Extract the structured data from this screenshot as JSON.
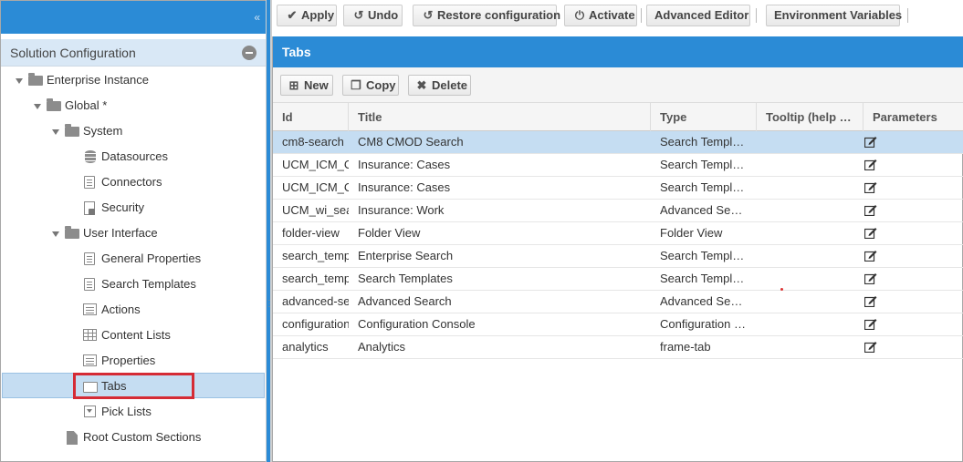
{
  "left": {
    "collapse_glyph": "«",
    "panel_title": "Solution Configuration",
    "tree": [
      {
        "label": "Enterprise Instance",
        "icon": "folder-icon"
      },
      {
        "label": "Global *",
        "icon": "folder-icon"
      },
      {
        "label": "System",
        "icon": "folder-icon"
      },
      {
        "label": "Datasources",
        "icon": "database-icon"
      },
      {
        "label": "Connectors",
        "icon": "document-icon"
      },
      {
        "label": "Security",
        "icon": "lock-document-icon"
      },
      {
        "label": "User Interface",
        "icon": "folder-icon"
      },
      {
        "label": "General Properties",
        "icon": "document-icon"
      },
      {
        "label": "Search Templates",
        "icon": "document-icon"
      },
      {
        "label": "Actions",
        "icon": "list-icon"
      },
      {
        "label": "Content Lists",
        "icon": "grid-icon"
      },
      {
        "label": "Properties",
        "icon": "list-icon"
      },
      {
        "label": "Tabs",
        "icon": "folder-outline-icon"
      },
      {
        "label": "Pick Lists",
        "icon": "picklist-icon"
      },
      {
        "label": "Root Custom Sections",
        "icon": "file-icon"
      }
    ]
  },
  "toolbar": {
    "apply": "Apply",
    "undo": "Undo",
    "restore": "Restore configuration",
    "activate": "Activate",
    "advanced_editor": "Advanced Editor",
    "env_vars": "Environment Variables"
  },
  "main": {
    "title": "Tabs",
    "actions": {
      "new": "New",
      "copy": "Copy",
      "delete": "Delete"
    },
    "columns": [
      "Id",
      "Title",
      "Type",
      "Tooltip (help …",
      "Parameters"
    ],
    "rows": [
      {
        "id": "cm8-search",
        "title": "CM8 CMOD Search",
        "type": "Search Templ…"
      },
      {
        "id": "UCM_ICM_C",
        "title": "Insurance: Cases",
        "type": "Search Templ…"
      },
      {
        "id": "UCM_ICM_C",
        "title": "Insurance: Cases",
        "type": "Search Templ…"
      },
      {
        "id": "UCM_wi_sea",
        "title": "Insurance: Work",
        "type": "Advanced Se…"
      },
      {
        "id": "folder-view",
        "title": "Folder View",
        "type": "Folder View"
      },
      {
        "id": "search_temp",
        "title": "Enterprise Search",
        "type": "Search Templ…"
      },
      {
        "id": "search_temp",
        "title": "Search Templates",
        "type": "Search Templ…"
      },
      {
        "id": "advanced-se",
        "title": "Advanced Search",
        "type": "Advanced Se…"
      },
      {
        "id": "configuration",
        "title": "Configuration Console",
        "type": "Configuration …"
      },
      {
        "id": "analytics",
        "title": "Analytics",
        "type": "frame-tab"
      }
    ]
  },
  "colors": {
    "accent": "#2b8bd6",
    "selection": "#c5ddf2",
    "highlight_box": "#d52b35"
  }
}
